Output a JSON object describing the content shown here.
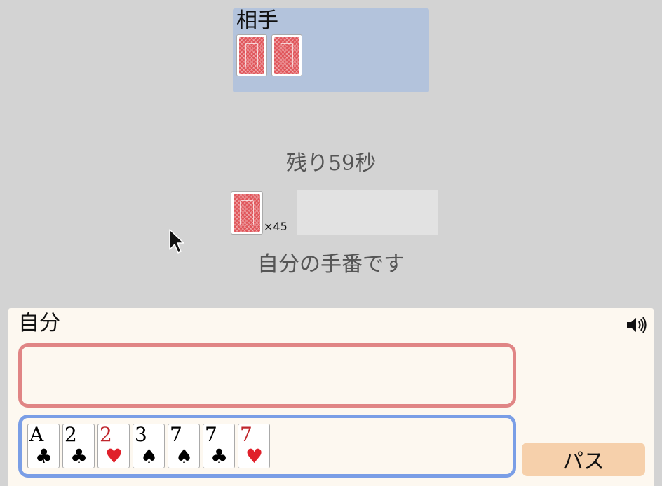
{
  "opponent": {
    "label": "相手",
    "cards_back_count_shown": 2
  },
  "timer": {
    "text": "残り59秒"
  },
  "deck": {
    "count_text": "×45"
  },
  "turn_message": "自分の手番です",
  "player": {
    "label": "自分"
  },
  "hand": {
    "cards": [
      {
        "rank": "A",
        "suit": "♣",
        "color": "#111111"
      },
      {
        "rank": "2",
        "suit": "♣",
        "color": "#111111"
      },
      {
        "rank": "2",
        "suit": "♥",
        "color": "#c0272d"
      },
      {
        "rank": "3",
        "suit": "♠",
        "color": "#111111"
      },
      {
        "rank": "7",
        "suit": "♠",
        "color": "#111111"
      },
      {
        "rank": "7",
        "suit": "♣",
        "color": "#111111"
      },
      {
        "rank": "7",
        "suit": "♥",
        "color": "#c0272d"
      }
    ]
  },
  "buttons": {
    "pass_label": "パス"
  },
  "icons": {
    "sound": "speaker-icon"
  },
  "colors": {
    "table_bg": "#d3d3d3",
    "opponent_area": "#b3c3dc",
    "player_area": "#fdf8f0",
    "play_zone_border": "#e08585",
    "hand_zone_border": "#7a9ee6",
    "pass_button": "#f6d0ab",
    "card_back": "#e0565b"
  }
}
